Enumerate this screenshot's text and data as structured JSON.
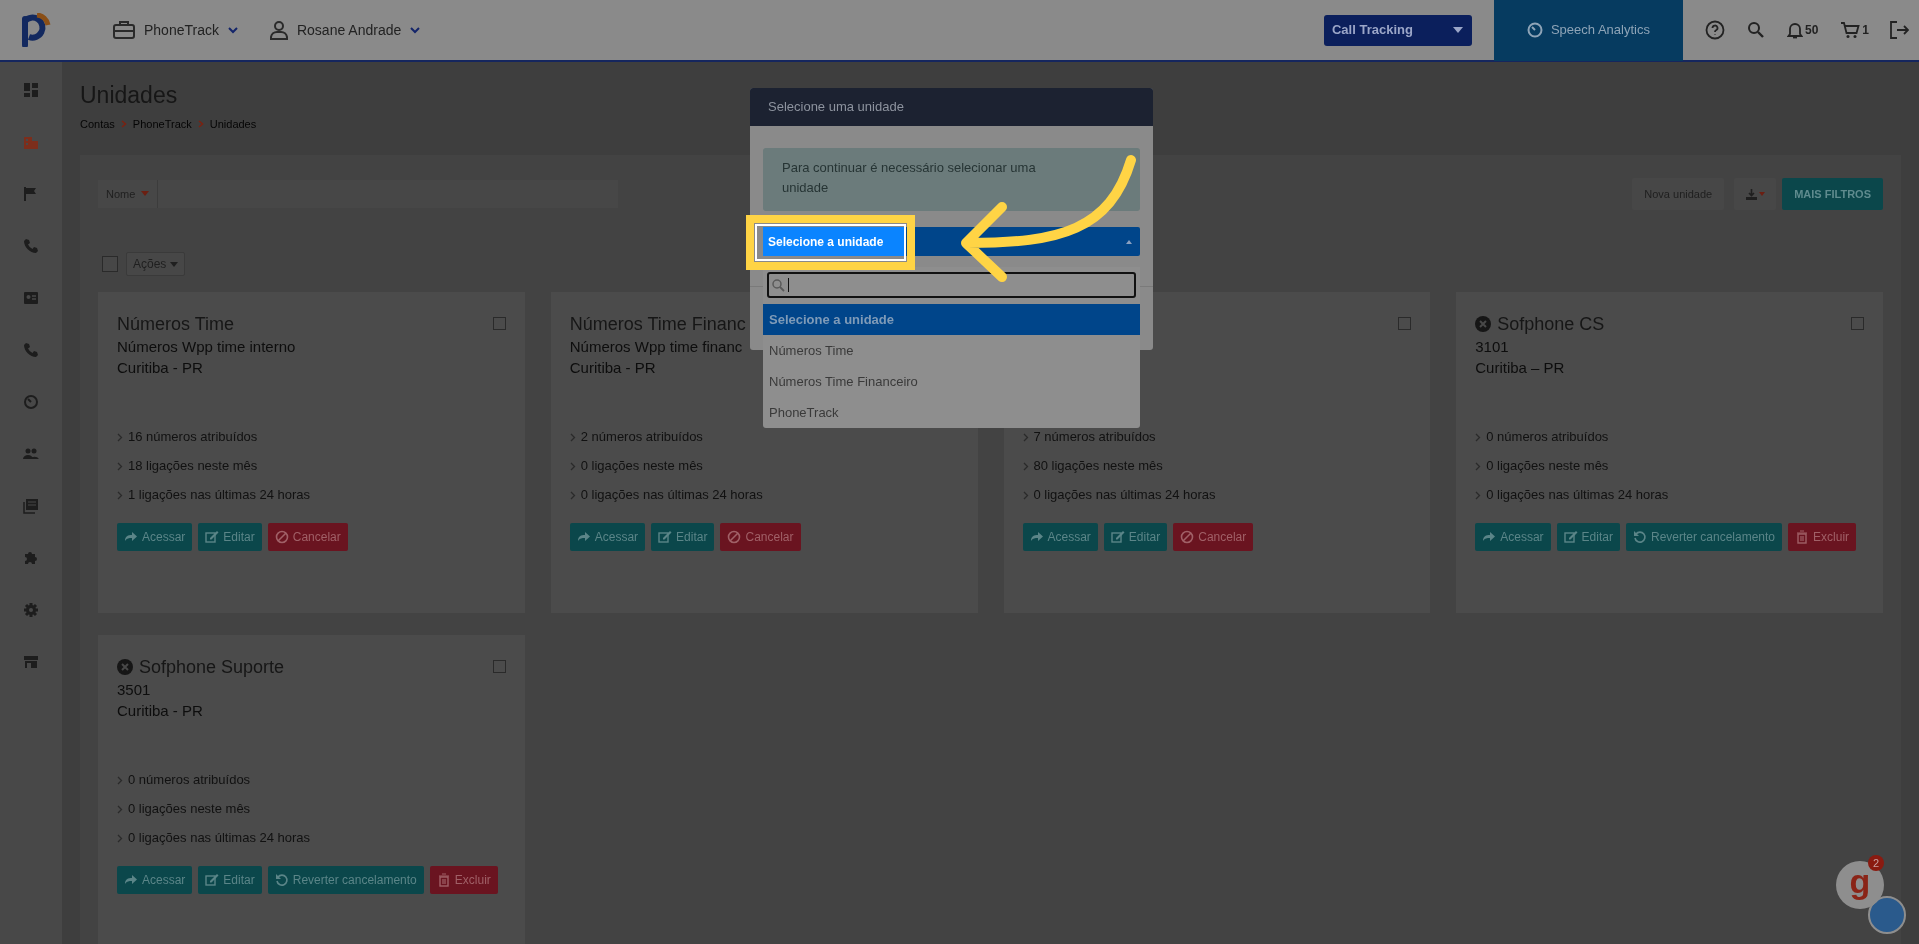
{
  "topbar": {
    "account": "PhoneTrack",
    "user": "Rosane Andrade",
    "product_select": "Call Tracking",
    "speech_button": "Speech Analytics",
    "notifications": "50",
    "cart": "1"
  },
  "sidebar": {
    "items": [
      {
        "selected": false
      },
      {
        "selected": true
      },
      {
        "selected": false
      },
      {
        "selected": false
      },
      {
        "selected": false
      },
      {
        "selected": false
      },
      {
        "selected": false
      },
      {
        "selected": false
      },
      {
        "selected": false
      },
      {
        "selected": false
      },
      {
        "selected": false
      },
      {
        "selected": false
      }
    ]
  },
  "page": {
    "title": "Unidades",
    "breadcrumb": [
      "Contas",
      "PhoneTrack",
      "Unidades"
    ]
  },
  "filters": {
    "field": "Nome",
    "new_button": "Nova unidade",
    "more_button": "MAIS FILTROS"
  },
  "bulk": {
    "checked": false,
    "actions": "Ações"
  },
  "cards": [
    {
      "title": "Números Time",
      "cancelled": false,
      "subtitle": "Números Wpp time interno",
      "location": "Curitiba - PR",
      "checked": false,
      "stats": [
        "16 números atribuídos",
        "18 ligações neste mês",
        "1 ligações nas últimas 24 horas"
      ],
      "buttons": [
        {
          "kind": "access",
          "label": "Acessar"
        },
        {
          "kind": "edit",
          "label": "Editar"
        },
        {
          "kind": "cancel",
          "label": "Cancelar"
        }
      ]
    },
    {
      "title": "Números Time Financ",
      "cancelled": false,
      "subtitle": "Números Wpp time financ",
      "location": "Curitiba - PR",
      "stats": [
        "2 números atribuídos",
        "0 ligações neste mês",
        "0 ligações nas últimas 24 horas"
      ],
      "buttons": [
        {
          "kind": "access",
          "label": "Acessar"
        },
        {
          "kind": "edit",
          "label": "Editar"
        },
        {
          "kind": "cancel",
          "label": "Cancelar"
        }
      ]
    },
    {
      "checked": false,
      "stats": [
        "7 números atribuídos",
        "80 ligações neste mês",
        "0 ligações nas últimas 24 horas"
      ],
      "buttons": [
        {
          "kind": "access",
          "label": "Acessar"
        },
        {
          "kind": "edit",
          "label": "Editar"
        },
        {
          "kind": "cancel",
          "label": "Cancelar"
        }
      ]
    },
    {
      "title": "Sofphone CS",
      "cancelled": true,
      "subtitle": "3101",
      "location": "Curitiba – PR",
      "checked": false,
      "stats": [
        "0 números atribuídos",
        "0 ligações neste mês",
        "0 ligações nas últimas 24 horas"
      ],
      "buttons": [
        {
          "kind": "access",
          "label": "Acessar"
        },
        {
          "kind": "edit",
          "label": "Editar"
        },
        {
          "kind": "revert",
          "label": "Reverter cancelamento"
        },
        {
          "kind": "delete",
          "label": "Excluir"
        }
      ]
    },
    {
      "title": "Sofphone Suporte",
      "cancelled": true,
      "subtitle": "3501",
      "location": "Curitiba - PR",
      "checked": false,
      "stats": [
        "0 números atribuídos",
        "0 ligações neste mês",
        "0 ligações nas últimas 24 horas"
      ],
      "buttons": [
        {
          "kind": "access",
          "label": "Acessar"
        },
        {
          "kind": "edit",
          "label": "Editar"
        },
        {
          "kind": "revert",
          "label": "Reverter cancelamento"
        },
        {
          "kind": "delete",
          "label": "Excluir"
        }
      ]
    }
  ],
  "modal": {
    "title": "Selecione uma unidade",
    "message": "Para continuar é necessário selecionar uma unidade",
    "select_value": "Selecione a unidade",
    "options": [
      {
        "label": "Selecione a unidade",
        "selected": true
      },
      {
        "label": "Números Time",
        "selected": false
      },
      {
        "label": "Números Time Financeiro",
        "selected": false
      },
      {
        "label": "PhoneTrack",
        "selected": false
      }
    ]
  },
  "help_widget": {
    "letter": "g",
    "badge": "2"
  }
}
